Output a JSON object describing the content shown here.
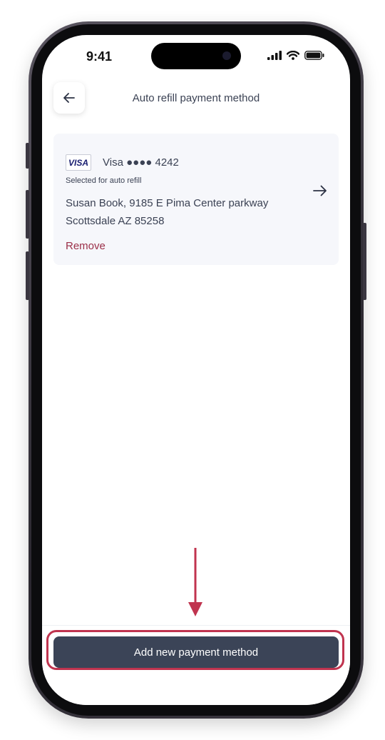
{
  "status_bar": {
    "time": "9:41"
  },
  "header": {
    "title": "Auto refill payment method"
  },
  "card": {
    "brand_logo": "VISA",
    "brand_label": "Visa ●●●● 4242",
    "status": "Selected for auto refill",
    "address_line1": "Susan Book,  9185 E Pima Center parkway",
    "address_line2": "Scottsdale AZ 85258",
    "remove_label": "Remove"
  },
  "footer": {
    "add_label": "Add new payment method"
  },
  "colors": {
    "primary": "#3b4457",
    "accent": "#9b2f48",
    "highlight": "#c0344f",
    "card_bg": "#f6f7fb"
  }
}
